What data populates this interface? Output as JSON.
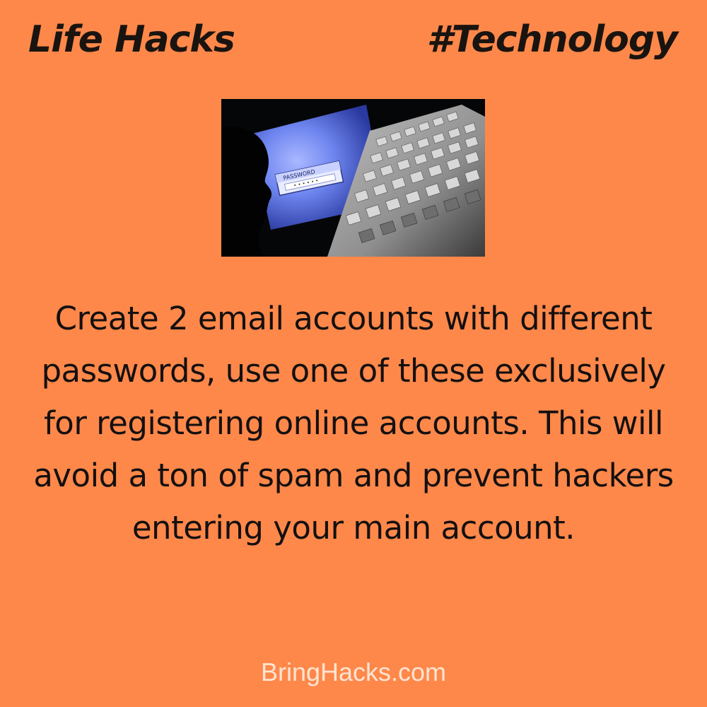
{
  "header": {
    "left_title": "Life Hacks",
    "right_title": "#Technology"
  },
  "photo": {
    "screen_label": "PASSWORD",
    "icon": "password-keyboard-photo"
  },
  "tip": {
    "text": "Create 2 email accounts with different passwords, use one of these exclusively for registering online accounts. This will avoid a ton of spam and prevent hackers entering your main account."
  },
  "footer": {
    "site": "BringHacks.com"
  },
  "colors": {
    "background": "#fe884a",
    "heading": "#1a1410",
    "body": "#141010",
    "footer": "#fde4d2"
  }
}
